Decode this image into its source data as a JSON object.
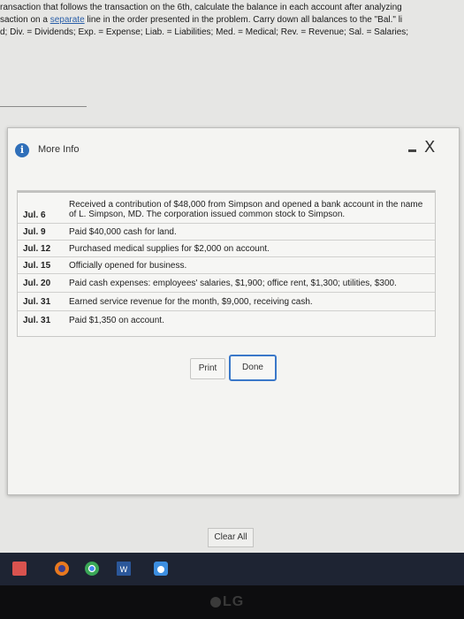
{
  "instructions": {
    "line1": "ransaction that follows the transaction on the 6th, calculate the balance in each account after analyzing",
    "line2a": "saction on a ",
    "line2_link": "separate",
    "line2b": " line in the order presented in the problem. Carry down all balances to the \"Bal.\" li",
    "line3": "d; Div. = Dividends; Exp. = Expense; Liab. = Liabilities; Med. = Medical; Rev. = Revenue; Sal. = Salaries;"
  },
  "modal": {
    "title": "More Info",
    "info_icon": "i",
    "minimize_icon": "minimize-icon",
    "close_symbol": "X",
    "rows": [
      {
        "date": "Jul. 6",
        "desc": "Received a contribution of $48,000 from Simpson and opened a bank account in the name of L. Simpson, MD. The corporation issued common stock to Simpson."
      },
      {
        "date": "Jul. 9",
        "desc": "Paid $40,000 cash for land."
      },
      {
        "date": "Jul. 12",
        "desc": "Purchased medical supplies for $2,000 on account."
      },
      {
        "date": "Jul. 15",
        "desc": "Officially opened for business."
      },
      {
        "date": "Jul. 20",
        "desc": "Paid cash expenses: employees' salaries, $1,900; office rent, $1,300; utilities, $300."
      },
      {
        "date": "Jul. 31",
        "desc": "Earned service revenue for the month, $9,000, receiving cash."
      },
      {
        "date": "Jul. 31",
        "desc": "Paid $1,350 on account."
      }
    ],
    "print_label": "Print",
    "done_label": "Done"
  },
  "clear_all_label": "Clear All",
  "monitor_brand": "LG",
  "colors": {
    "accent": "#3a78c9",
    "info": "#2f6fb9",
    "link": "#2a5fa8"
  }
}
